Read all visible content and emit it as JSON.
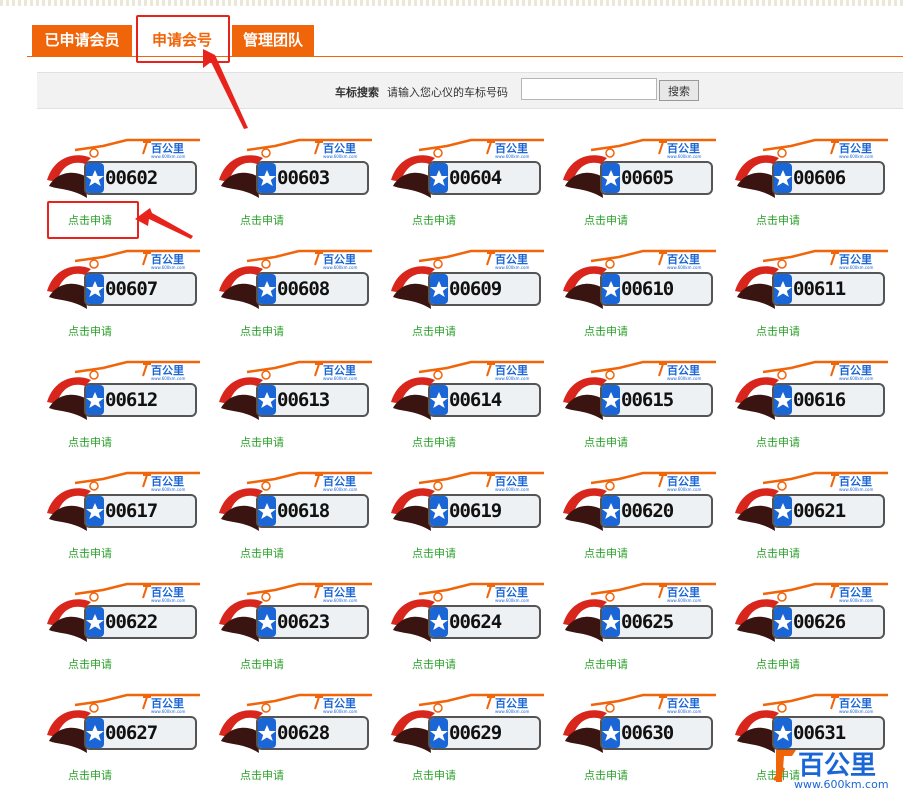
{
  "tabs": [
    {
      "label": "已申请会员",
      "active": false
    },
    {
      "label": "申请会号",
      "active": true
    },
    {
      "label": "管理团队",
      "active": false
    }
  ],
  "search": {
    "label": "车标搜索",
    "hint": "请输入您心仪的车标号码",
    "value": "",
    "button_label": "搜索"
  },
  "plate_logo_text": "百公里",
  "plate_logo_url_text": "www.600km.com",
  "plates": [
    {
      "number": "00602",
      "link": "点击申请"
    },
    {
      "number": "00603",
      "link": "点击申请"
    },
    {
      "number": "00604",
      "link": "点击申请"
    },
    {
      "number": "00605",
      "link": "点击申请"
    },
    {
      "number": "00606",
      "link": "点击申请"
    },
    {
      "number": "00607",
      "link": "点击申请"
    },
    {
      "number": "00608",
      "link": "点击申请"
    },
    {
      "number": "00609",
      "link": "点击申请"
    },
    {
      "number": "00610",
      "link": "点击申请"
    },
    {
      "number": "00611",
      "link": "点击申请"
    },
    {
      "number": "00612",
      "link": "点击申请"
    },
    {
      "number": "00613",
      "link": "点击申请"
    },
    {
      "number": "00614",
      "link": "点击申请"
    },
    {
      "number": "00615",
      "link": "点击申请"
    },
    {
      "number": "00616",
      "link": "点击申请"
    },
    {
      "number": "00617",
      "link": "点击申请"
    },
    {
      "number": "00618",
      "link": "点击申请"
    },
    {
      "number": "00619",
      "link": "点击申请"
    },
    {
      "number": "00620",
      "link": "点击申请"
    },
    {
      "number": "00621",
      "link": "点击申请"
    },
    {
      "number": "00622",
      "link": "点击申请"
    },
    {
      "number": "00623",
      "link": "点击申请"
    },
    {
      "number": "00624",
      "link": "点击申请"
    },
    {
      "number": "00625",
      "link": "点击申请"
    },
    {
      "number": "00626",
      "link": "点击申请"
    },
    {
      "number": "00627",
      "link": "点击申请"
    },
    {
      "number": "00628",
      "link": "点击申请"
    },
    {
      "number": "00629",
      "link": "点击申请"
    },
    {
      "number": "00630",
      "link": "点击申请"
    },
    {
      "number": "00631",
      "link": "点击申请"
    }
  ],
  "watermark": {
    "brand": "百公里",
    "url": "www.600km.com"
  },
  "colors": {
    "accent": "#f0640a",
    "link": "#2aa02a",
    "plate_blue": "#1b66d6",
    "plate_red": "#d8261c",
    "annotation": "#e8231b"
  }
}
